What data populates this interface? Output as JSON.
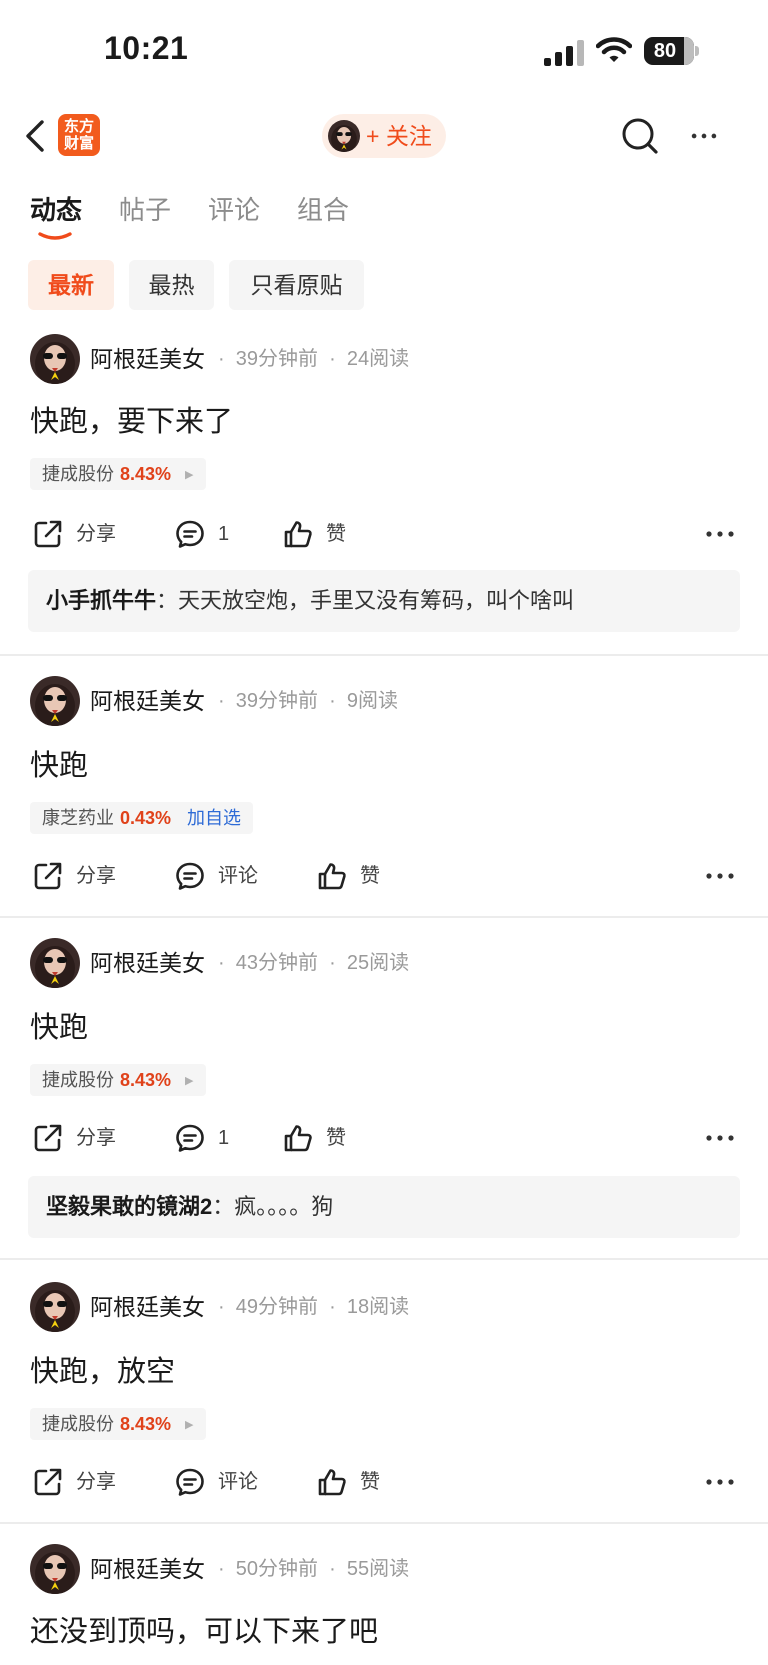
{
  "status": {
    "time": "10:21",
    "battery": "80"
  },
  "nav": {
    "brand_line1": "东方",
    "brand_line2": "财富",
    "follow_label": "+ 关注"
  },
  "tabs": [
    "动态",
    "帖子",
    "评论",
    "组合"
  ],
  "filters": [
    "最新",
    "最热",
    "只看原贴"
  ],
  "labels": {
    "share": "分享",
    "comment": "评论",
    "like": "赞",
    "add_watch": "加自选"
  },
  "posts": [
    {
      "author": "阿根廷美女",
      "meta": "·  39分钟前  ·  24阅读",
      "text": "快跑，要下来了",
      "stock": {
        "name": "捷成股份",
        "pct": "8.43%"
      },
      "comment_count": "1",
      "reply": {
        "user": "小手抓牛牛",
        "text": "：天天放空炮，手里又没有筹码，叫个啥叫"
      }
    },
    {
      "author": "阿根廷美女",
      "meta": "·  39分钟前  ·  9阅读",
      "text": "快跑",
      "stock": {
        "name": "康芝药业",
        "pct": "0.43%"
      },
      "comment_count": "评论"
    },
    {
      "author": "阿根廷美女",
      "meta": "·  43分钟前  ·  25阅读",
      "text": "快跑",
      "stock": {
        "name": "捷成股份",
        "pct": "8.43%"
      },
      "comment_count": "1",
      "reply": {
        "user": "坚毅果敢的镜湖2",
        "text": "：疯。。。。狗"
      }
    },
    {
      "author": "阿根廷美女",
      "meta": "·  49分钟前  ·  18阅读",
      "text": "快跑，放空",
      "stock": {
        "name": "捷成股份",
        "pct": "8.43%"
      },
      "comment_count": "评论"
    },
    {
      "author": "阿根廷美女",
      "meta": "·  50分钟前  ·  55阅读",
      "text": "还没到顶吗，可以下来了吧"
    }
  ]
}
